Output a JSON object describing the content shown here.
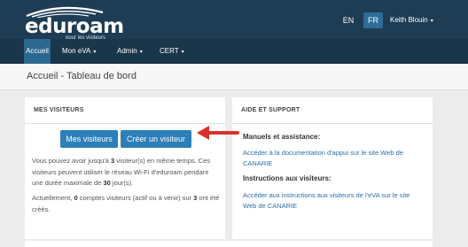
{
  "brand": {
    "name": "eduroam",
    "tagline": "pour les visiteurs"
  },
  "header": {
    "languages": [
      {
        "label": "EN",
        "active": false
      },
      {
        "label": "FR",
        "active": true
      }
    ],
    "user_name": "Keith Blouin"
  },
  "nav": [
    {
      "label": "Accueil",
      "active": true,
      "has_menu": false
    },
    {
      "label": "Mon eVA",
      "active": false,
      "has_menu": true
    },
    {
      "label": "Admin",
      "active": false,
      "has_menu": true
    },
    {
      "label": "CERT",
      "active": false,
      "has_menu": true
    }
  ],
  "page": {
    "title": "Accueil - Tableau de bord"
  },
  "visitors_card": {
    "title": "MES VISITEURS",
    "buttons": {
      "list_label": "Mes visiteurs",
      "create_label": "Créer un visiteur"
    },
    "text1": {
      "before": "Vous pouvez avoir jusqu'à ",
      "max": "3",
      "middle": " visiteur(s) en même temps. Ces visiteurs peuvent utiliser le réseau Wi-Fi d'eduroam pendant une durée maximale de ",
      "days": "30",
      "after": " jour(s)."
    },
    "text2": {
      "before": "Actuellement, ",
      "count": "0",
      "middle": " comptes visiteurs (actif ou à venir) sur ",
      "total": "3",
      "after": " ont été créés."
    }
  },
  "support_card": {
    "title": "AIDE ET SUPPORT",
    "manuals_heading": "Manuels et assistance:",
    "manuals_link": "Accéder à la documentation d'appui sur le site Web de CANARIE",
    "instructions_heading": "Instructions aux visiteurs:",
    "instructions_link": "Accéder aux instructions aux visiteurs de l'eVA sur le site Web de CANARIE"
  },
  "colors": {
    "topbar": "#1e3d55",
    "navbar": "#1a364b",
    "active_nav": "#2b6890",
    "button": "#2c7fb8",
    "link": "#2a6ea8",
    "annotation_arrow": "#d9322c"
  },
  "icons": {
    "dropdown": "chevron-down-icon",
    "annotation": "red-arrow-icon"
  }
}
